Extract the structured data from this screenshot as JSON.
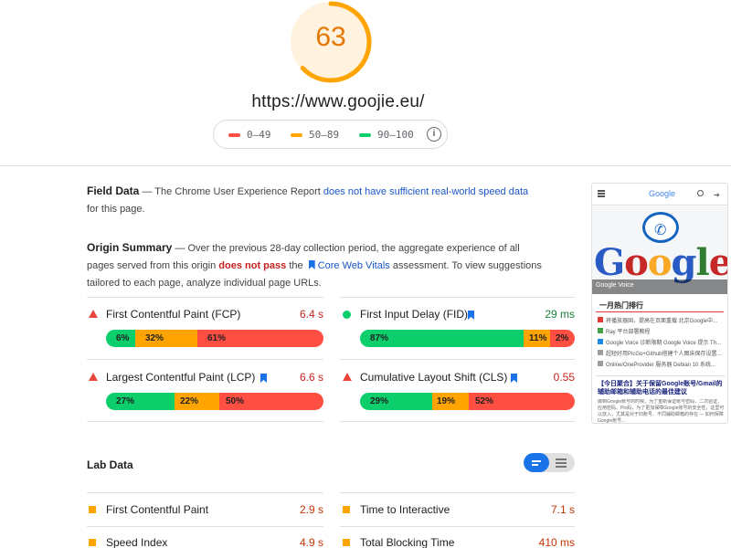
{
  "score": {
    "value": "63",
    "fraction": 0.63,
    "color": "#ffa400"
  },
  "url": "https://www.goojie.eu/",
  "legend": {
    "red": "0–49",
    "orange": "50–89",
    "green": "90–100"
  },
  "field_data": {
    "title": "Field Data",
    "text_a": " — The Chrome User Experience Report ",
    "link": "does not have sufficient real-world speed data",
    "text_b": " for this page."
  },
  "origin_summary": {
    "title": "Origin Summary",
    "text_a": " — Over the previous 28-day collection period, the aggregate experience of all pages served from this origin ",
    "fail": "does not pass",
    "text_b": " the ",
    "link": "Core Web Vitals",
    "text_c": " assessment. To view suggestions tailored to each page, analyze individual page URLs."
  },
  "field_metrics": [
    {
      "name": "First Contentful Paint (FCP)",
      "value": "6.4 s",
      "status": "fail",
      "segments": [
        "6%",
        "32%",
        "61%"
      ]
    },
    {
      "name": "First Input Delay (FID)",
      "value": "29 ms",
      "status": "pass",
      "segments": [
        "87%",
        "11%",
        "2%"
      ]
    },
    {
      "name": "Largest Contentful Paint (LCP)",
      "value": "6.6 s",
      "status": "fail",
      "segments": [
        "27%",
        "22%",
        "50%"
      ]
    },
    {
      "name": "Cumulative Layout Shift (CLS)",
      "value": "0.55",
      "status": "fail",
      "segments": [
        "29%",
        "19%",
        "52%"
      ]
    }
  ],
  "lab_data": {
    "title": "Lab Data",
    "metrics": [
      {
        "name": "First Contentful Paint",
        "value": "2.9 s"
      },
      {
        "name": "Time to Interactive",
        "value": "7.1 s"
      },
      {
        "name": "Speed Index",
        "value": "4.9 s"
      },
      {
        "name": "Total Blocking Time",
        "value": "410 ms"
      }
    ]
  },
  "thumbnail": {
    "header_logo": "Google",
    "hero_word": "Google",
    "hero_caption": "Google Voice",
    "section_title": "一月热门排行",
    "list": [
      "将播放器固，提高在页面重载 北京Google中...",
      "Ray 平台部署教程",
      "Google Voice 诊断限期 Google Voice 提示 Th...",
      "超短好用PicGo+Github搭建个人图床保存设置...",
      "Online/OneProvider 服务器 Debian 10 系统..."
    ],
    "article_title": "【今日聚合】关于保留Google账号/Gmail的辅助邮箱和辅助电话的最佳建议",
    "article_body": "做到Google账号的时候，为了重新保证账号密码，二次验证、应用密码、Pin码，为了更加保障Google账号的安全性，这里可以放入，尤其是对于旧账号、不同辅助邮箱的存在 — 如何保障Google账号..."
  },
  "colors": {
    "red": "#ff4e42",
    "orange": "#ffa400",
    "green": "#0cce6b",
    "link": "#1a56c6"
  }
}
